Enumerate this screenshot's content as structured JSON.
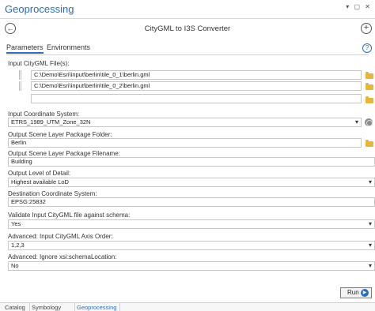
{
  "pane": {
    "title": "Geoprocessing",
    "controls": "▾ ▢ ✕"
  },
  "tool": {
    "back_glyph": "←",
    "title": "CityGML to I3S Converter",
    "add_glyph": "+"
  },
  "tabs": [
    {
      "label": "Parameters",
      "active": true
    },
    {
      "label": "Environments",
      "active": false
    }
  ],
  "help_glyph": "?",
  "params": {
    "input_files": {
      "label": "Input CityGML File(s):",
      "values": [
        "C:\\Demo\\Esri\\input\\berlin\\tile_0_1\\berlin.gml",
        "C:\\Demo\\Esri\\input\\berlin\\tile_0_2\\berlin.gml",
        ""
      ]
    },
    "input_crs": {
      "label": "Input Coordinate System:",
      "value": "ETRS_1989_UTM_Zone_32N"
    },
    "output_folder": {
      "label": "Output Scene Layer Package Folder:",
      "value": "Berlin"
    },
    "output_filename": {
      "label": "Output Scene Layer Package Filename:",
      "value": "Building"
    },
    "lod": {
      "label": "Output Level of Detail:",
      "value": "Highest available LoD"
    },
    "dest_crs": {
      "label": "Destination Coordinate System:",
      "value": "EPSG:25832"
    },
    "validate": {
      "label": "Validate Input CityGML file against schema:",
      "value": "Yes"
    },
    "axis_order": {
      "label": "Advanced: Input CityGML Axis Order:",
      "value": "1,2,3"
    },
    "ignore_schema": {
      "label": "Advanced: Ignore xsi:schemaLocation:",
      "value": "No"
    }
  },
  "run": {
    "label": "Run",
    "glyph": "▶"
  },
  "bottom_tabs": [
    {
      "label": "Catalog",
      "active": false
    },
    {
      "label": "Symbology",
      "active": false
    },
    {
      "label": "Geoprocessing",
      "active": true
    }
  ],
  "colors": {
    "accent": "#2a6ebb",
    "folder": "#e8b53a"
  }
}
